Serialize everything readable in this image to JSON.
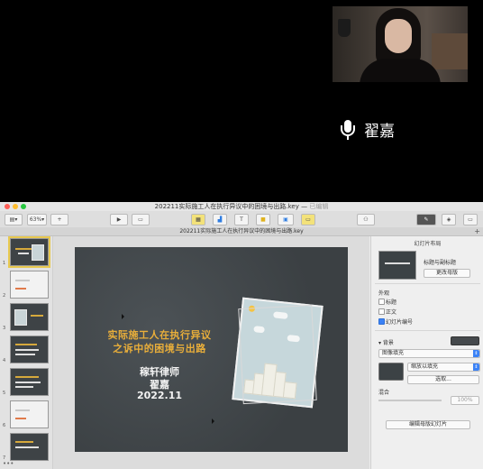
{
  "call": {
    "speaker_name": "翟嘉"
  },
  "window": {
    "title": "202211实际施工人在执行异议中的困境与出路.key",
    "title_status": "已编辑",
    "zoom": "63%",
    "doc_tab": "202211实际施工人在执行异议中的困境与出路.key",
    "add_tab": "+"
  },
  "navigator": {
    "slide_numbers": [
      "1",
      "2",
      "3",
      "4",
      "5",
      "6",
      "7"
    ],
    "footer": "•••"
  },
  "slide": {
    "title_line1": "实际施工人在执行异议",
    "title_line2": "之诉中的困境与出路",
    "firm": "稼轩律师",
    "author": "翟嘉",
    "date": "2022.11"
  },
  "inspector": {
    "header": "幻灯片布局",
    "master_name": "标题与副标题",
    "change_master": "更改母版",
    "appearance_label": "外观",
    "options": [
      {
        "label": "标题",
        "checked": false
      },
      {
        "label": "正文",
        "checked": false
      },
      {
        "label": "幻灯片编号",
        "checked": true
      }
    ],
    "background_label": "背景",
    "fill_type": "图像填充",
    "scale_mode": "缩放以填充",
    "choose_button": "选取...",
    "blend_label": "混合",
    "blend_value": "100%",
    "edit_master_button": "编辑母版幻灯片"
  }
}
